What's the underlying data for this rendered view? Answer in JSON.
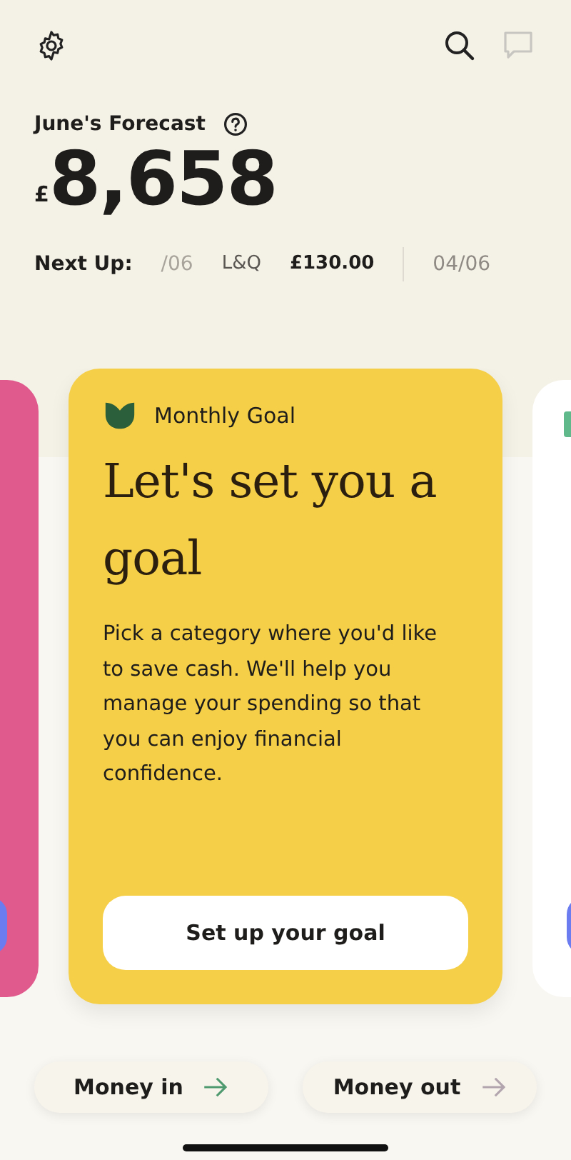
{
  "header": {
    "forecast_label": "June's Forecast",
    "currency": "£",
    "amount": "8,658"
  },
  "next_up": {
    "label": "Next Up:",
    "items": [
      {
        "date": "/06",
        "payee": "L&Q",
        "amount": "£130.00",
        "faded": true
      },
      {
        "date": "04/06",
        "faded": false
      }
    ]
  },
  "cards": [
    {
      "kind": "peek-left",
      "color": "#e05a8e"
    },
    {
      "kind": "goal",
      "color": "#f5cf47",
      "tag": "Monthly Goal",
      "title": "Let's set you a goal",
      "body": "Pick a category where you'd like to save cash. We'll help you manage your spending so that you can enjoy financial confidence.",
      "button": "Set up your goal"
    },
    {
      "kind": "peek-right",
      "color": "#ffffff"
    }
  ],
  "actions": [
    {
      "label": "Money in",
      "color": "#4f9a6e"
    },
    {
      "label": "Money out",
      "color": "#b3a5ad"
    }
  ]
}
